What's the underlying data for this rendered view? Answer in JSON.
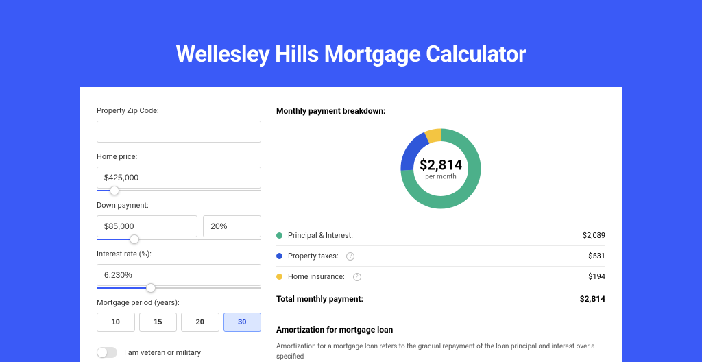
{
  "page": {
    "title": "Wellesley Hills Mortgage Calculator"
  },
  "inputs": {
    "zip": {
      "label": "Property Zip Code:",
      "value": ""
    },
    "home_price": {
      "label": "Home price:",
      "value": "$425,000",
      "slider_pct": 8
    },
    "down_payment": {
      "label": "Down payment:",
      "amount": "$85,000",
      "percent": "20%",
      "slider_pct": 20
    },
    "interest_rate": {
      "label": "Interest rate (%):",
      "value": "6.230%",
      "slider_pct": 30
    },
    "period": {
      "label": "Mortgage period (years):",
      "options": [
        "10",
        "15",
        "20",
        "30"
      ],
      "active_index": 3
    },
    "veteran": {
      "label": "I am veteran or military",
      "on": false
    }
  },
  "breakdown": {
    "title": "Monthly payment breakdown:",
    "center_value": "$2,814",
    "center_sub": "per month",
    "items": [
      {
        "label": "Principal & Interest:",
        "value": "$2,089",
        "color": "#4cb08a",
        "info": false
      },
      {
        "label": "Property taxes:",
        "value": "$531",
        "color": "#2f57d9",
        "info": true
      },
      {
        "label": "Home insurance:",
        "value": "$194",
        "color": "#f3c542",
        "info": true
      }
    ],
    "total_label": "Total monthly payment:",
    "total_value": "$2,814"
  },
  "chart_data": {
    "type": "pie",
    "title": "Monthly payment breakdown",
    "series": [
      {
        "name": "Principal & Interest",
        "value": 2089,
        "color": "#4cb08a"
      },
      {
        "name": "Property taxes",
        "value": 531,
        "color": "#2f57d9"
      },
      {
        "name": "Home insurance",
        "value": 194,
        "color": "#f3c542"
      }
    ],
    "center_label": "$2,814 per month",
    "donut": true
  },
  "amortization": {
    "title": "Amortization for mortgage loan",
    "body": "Amortization for a mortgage loan refers to the gradual repayment of the loan principal and interest over a specified"
  }
}
